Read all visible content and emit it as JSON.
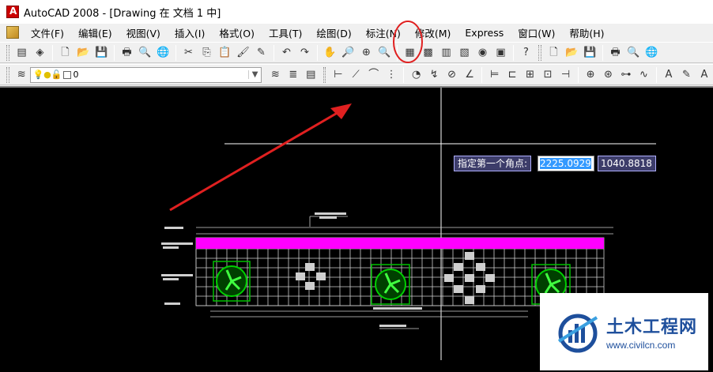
{
  "window": {
    "title": "AutoCAD 2008 - [Drawing 在 文档 1 中]"
  },
  "menu": [
    {
      "label": "文件(F)"
    },
    {
      "label": "编辑(E)"
    },
    {
      "label": "视图(V)"
    },
    {
      "label": "插入(I)"
    },
    {
      "label": "格式(O)"
    },
    {
      "label": "工具(T)"
    },
    {
      "label": "绘图(D)"
    },
    {
      "label": "标注(N)"
    },
    {
      "label": "修改(M)"
    },
    {
      "label": "Express"
    },
    {
      "label": "窗口(W)"
    },
    {
      "label": "帮助(H)"
    }
  ],
  "toolbar1_icons": [
    "drawing-recovery",
    "design-center",
    "new",
    "open",
    "save",
    "plot",
    "plot-preview",
    "publish",
    "cut",
    "copy",
    "paste",
    "match-properties",
    "block-editor",
    "undo",
    "redo",
    "pan",
    "zoom-realtime",
    "zoom-window",
    "zoom-previous",
    "properties",
    "design-center",
    "tool-palettes",
    "sheet-set",
    "markup",
    "calculator",
    "help",
    "new",
    "open",
    "save",
    "plot",
    "plot-preview",
    "publish"
  ],
  "layer": {
    "current": "0"
  },
  "toolbar2_icons": [
    "linear-dim",
    "aligned-dim",
    "arc-length-dim",
    "ordinate-dim",
    "radius-dim",
    "jogged-dim",
    "diameter-dim",
    "angular-dim",
    "quick-dim",
    "baseline-dim",
    "continue-dim",
    "quick-leader",
    "tolerance",
    "center-mark",
    "dim-edit",
    "dim-text-edit",
    "dim-update",
    "dim-style"
  ],
  "dynamic_input": {
    "prompt": "指定第一个角点:",
    "x": "2225.0929",
    "y": "1040.8818"
  },
  "watermark": {
    "name": "土木工程网",
    "url": "www.civilcn.com"
  },
  "colors": {
    "canvas": "#000000",
    "magenta_band": "#ff00ff",
    "fan_green": "#00c000",
    "annotation_red": "#e02020"
  }
}
